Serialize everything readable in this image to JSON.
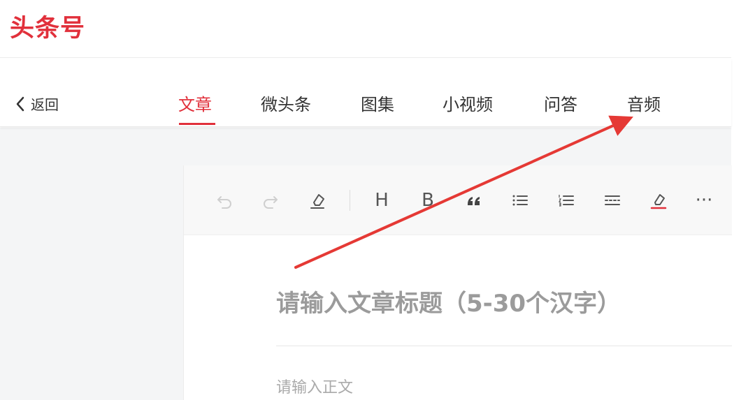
{
  "header": {
    "logo_text": "头条号"
  },
  "nav": {
    "back_label": "返回",
    "tabs": [
      {
        "label": "文章",
        "active": true
      },
      {
        "label": "微头条",
        "active": false
      },
      {
        "label": "图集",
        "active": false
      },
      {
        "label": "小视频",
        "active": false
      },
      {
        "label": "问答",
        "active": false
      },
      {
        "label": "音频",
        "active": false
      }
    ]
  },
  "toolbar": {
    "items": [
      "undo-icon",
      "redo-icon",
      "clear-format-icon",
      "heading",
      "bold",
      "quote-icon",
      "bullet-list-icon",
      "ordered-list-icon",
      "divider-icon",
      "highlight-icon",
      "more-icon"
    ],
    "heading_label": "H",
    "bold_label": "B",
    "more_label": "···"
  },
  "editor": {
    "title_placeholder": "请输入文章标题（5-30个汉字）",
    "body_placeholder": "请输入正文"
  },
  "colors": {
    "brand": "#e1303b",
    "annotation_arrow": "#e53935"
  }
}
